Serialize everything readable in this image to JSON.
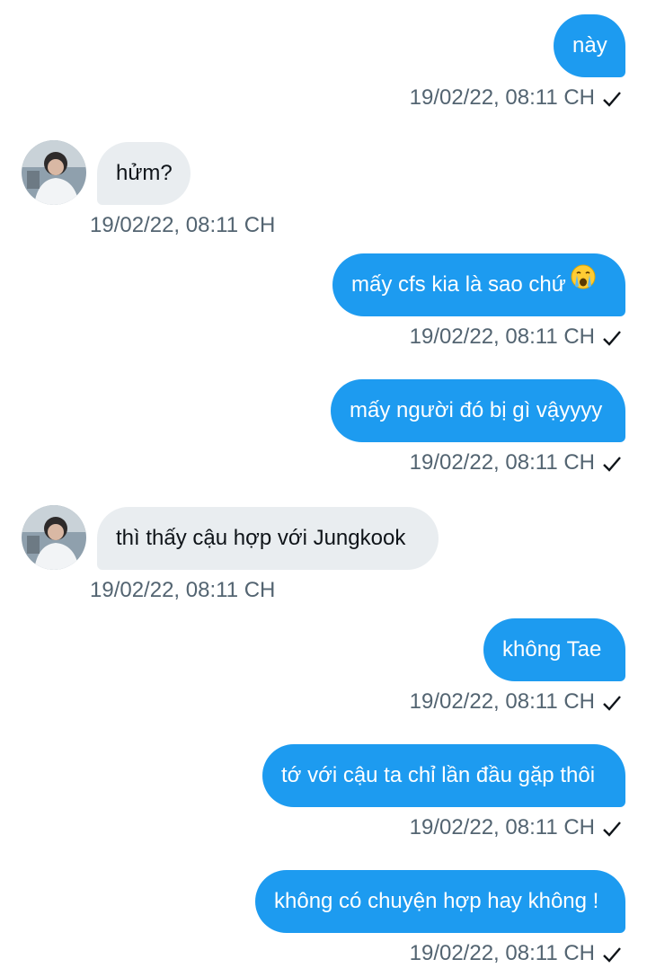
{
  "conversation": {
    "messages": [
      {
        "direction": "sent",
        "text": "này",
        "timestamp": "19/02/22, 08:11 CH",
        "status_icon": "check-icon"
      },
      {
        "direction": "received",
        "text": "hửm?",
        "timestamp": "19/02/22, 08:11 CH",
        "avatar": "avatar"
      },
      {
        "direction": "sent",
        "text": "mấy cfs kia là sao chứ",
        "emoji": "crying-face-emoji",
        "timestamp": "19/02/22, 08:11 CH",
        "status_icon": "check-icon"
      },
      {
        "direction": "sent",
        "text": "mấy người đó bị gì vậyyyy",
        "timestamp": "19/02/22, 08:11 CH",
        "status_icon": "check-icon"
      },
      {
        "direction": "received",
        "text": "thì thấy cậu hợp với Jungkook",
        "timestamp": "19/02/22, 08:11 CH",
        "avatar": "avatar"
      },
      {
        "direction": "sent",
        "text": "không Tae",
        "timestamp": "19/02/22, 08:11 CH",
        "status_icon": "check-icon"
      },
      {
        "direction": "sent",
        "text": "tớ với cậu ta chỉ lần đầu gặp thôi",
        "timestamp": "19/02/22, 08:11 CH",
        "status_icon": "check-icon"
      },
      {
        "direction": "sent",
        "text": "không có chuyện hợp hay không !",
        "timestamp": "19/02/22, 08:11 CH",
        "status_icon": "check-icon"
      }
    ]
  },
  "colors": {
    "sent_bubble": "#1d9bf0",
    "received_bubble": "#e9edf0",
    "timestamp": "#536471",
    "text_dark": "#0f1419"
  }
}
